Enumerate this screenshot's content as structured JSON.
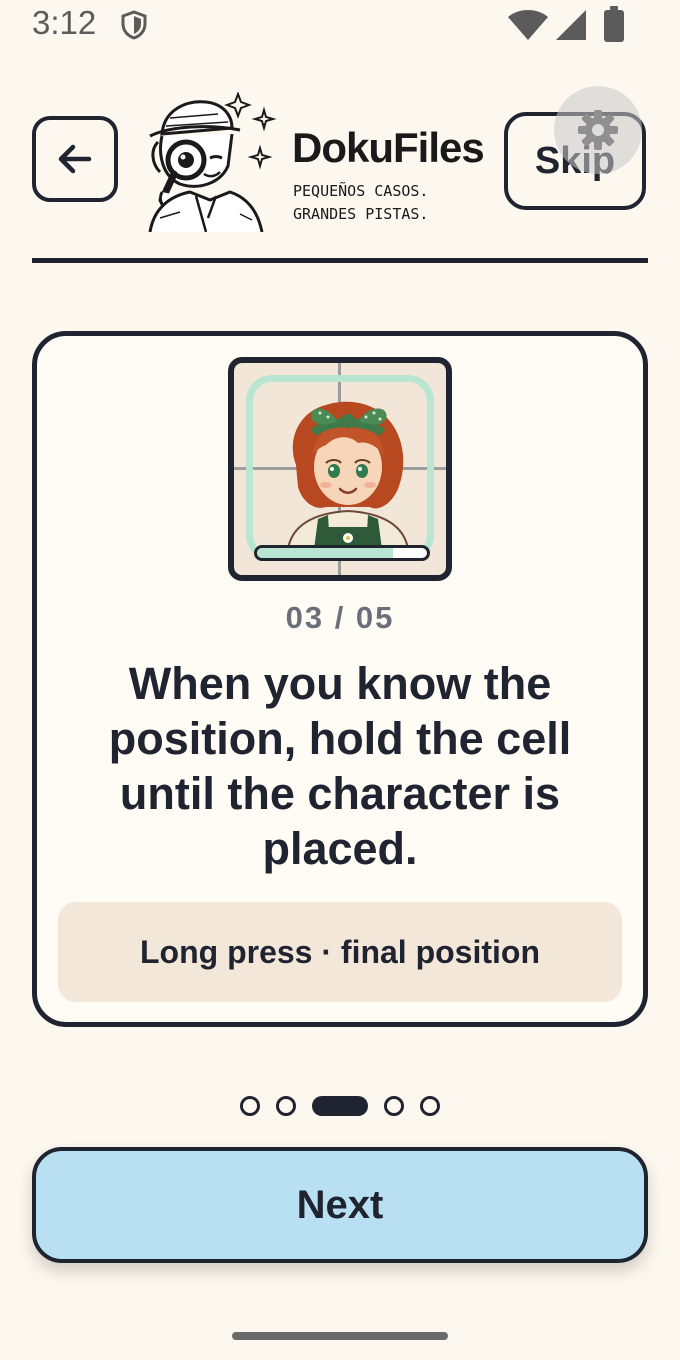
{
  "status_bar": {
    "time": "3:12",
    "icons": [
      "shield-icon",
      "wifi-icon",
      "signal-icon",
      "battery-icon"
    ]
  },
  "header": {
    "back_icon": "arrow-left-icon",
    "logo_icon": "detective-magnifier-icon",
    "brand_name": "DokuFiles",
    "tagline": "PEQUEÑOS CASOS.\nGRANDES PISTAS.",
    "skip_label": "Skip",
    "settings_icon": "gear-icon"
  },
  "card": {
    "step": "03 / 05",
    "hold_progress": 0.8,
    "text": "When you know the position, hold the cell until the character is placed.",
    "hint": "Long press · final position"
  },
  "pagination": {
    "total": 5,
    "active": 3
  },
  "footer": {
    "next_label": "Next"
  },
  "colors": {
    "background": "#fdf8ef",
    "ink": "#1f2430",
    "next_button": "#b9e0f2",
    "highlight": "#b9e6d2",
    "hint_background": "#f3e7d9"
  }
}
